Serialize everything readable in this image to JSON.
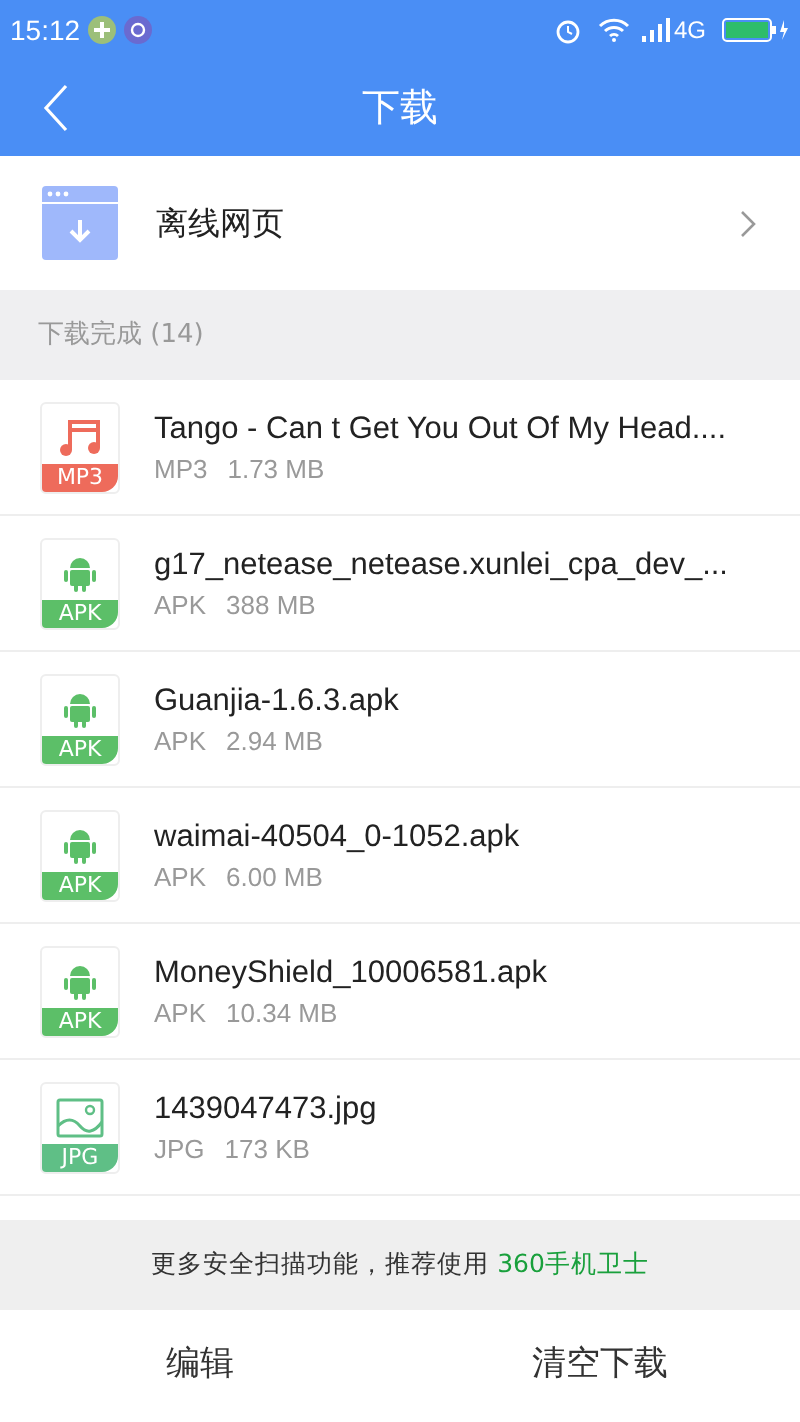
{
  "status_bar": {
    "time": "15:12",
    "network": "4G"
  },
  "header": {
    "title": "下载"
  },
  "offline": {
    "label": "离线网页"
  },
  "section": {
    "title": "下载完成 (14)"
  },
  "files": [
    {
      "kind": "music",
      "badge": "MP3",
      "color": "#ee6b5b",
      "name": "Tango - Can t Get You Out Of My Head....",
      "type": "MP3",
      "size": "1.73 MB"
    },
    {
      "kind": "android",
      "badge": "APK",
      "color": "#5cbf68",
      "name": "g17_netease_netease.xunlei_cpa_dev_...",
      "type": "APK",
      "size": "388 MB"
    },
    {
      "kind": "android",
      "badge": "APK",
      "color": "#5cbf68",
      "name": "Guanjia-1.6.3.apk",
      "type": "APK",
      "size": "2.94 MB"
    },
    {
      "kind": "android",
      "badge": "APK",
      "color": "#5cbf68",
      "name": "waimai-40504_0-1052.apk",
      "type": "APK",
      "size": "6.00 MB"
    },
    {
      "kind": "android",
      "badge": "APK",
      "color": "#5cbf68",
      "name": "MoneyShield_10006581.apk",
      "type": "APK",
      "size": "10.34 MB"
    },
    {
      "kind": "image",
      "badge": "JPG",
      "color": "#5fbf86",
      "name": "1439047473.jpg",
      "type": "JPG",
      "size": "173 KB"
    }
  ],
  "banner": {
    "text": "更多安全扫描功能，推荐使用",
    "link": "360手机卫士"
  },
  "bottom_bar": [
    "编辑",
    "清空下载"
  ]
}
